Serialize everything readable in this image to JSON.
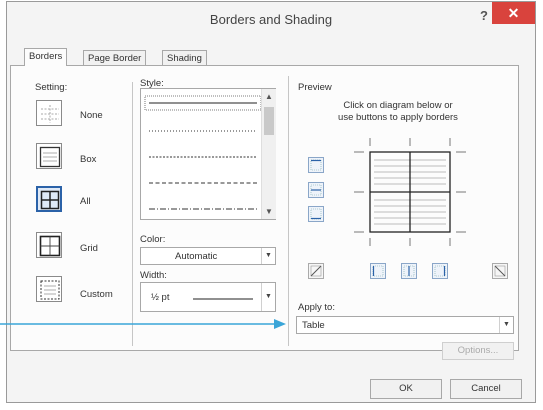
{
  "window": {
    "title": "Borders and Shading",
    "help_glyph": "?",
    "close_glyph": "✕"
  },
  "tabs": [
    {
      "label": "Borders",
      "active": true
    },
    {
      "label": "Page Border",
      "active": false
    },
    {
      "label": "Shading",
      "active": false
    }
  ],
  "setting": {
    "label": "Setting:",
    "options": [
      {
        "label": "None",
        "icon": "border-none-icon"
      },
      {
        "label": "Box",
        "icon": "border-box-icon"
      },
      {
        "label": "All",
        "icon": "border-all-icon",
        "selected": true
      },
      {
        "label": "Grid",
        "icon": "border-grid-icon"
      },
      {
        "label": "Custom",
        "icon": "border-custom-icon"
      }
    ]
  },
  "style": {
    "label": "Style:",
    "items": [
      "solid",
      "dotted",
      "dashed-small",
      "dashed",
      "dash-dot"
    ]
  },
  "color": {
    "label": "Color:",
    "value": "Automatic"
  },
  "width": {
    "label": "Width:",
    "value": "½ pt"
  },
  "preview": {
    "label": "Preview",
    "instructions_line1": "Click on diagram below or",
    "instructions_line2": "use buttons to apply borders"
  },
  "apply_to": {
    "label": "Apply to:",
    "value": "Table"
  },
  "buttons": {
    "options": "Options...",
    "ok": "OK",
    "cancel": "Cancel"
  },
  "colors": {
    "accent": "#2b62a8",
    "close_bg": "#d9433d",
    "annotation_arrow": "#3aa5d8"
  }
}
